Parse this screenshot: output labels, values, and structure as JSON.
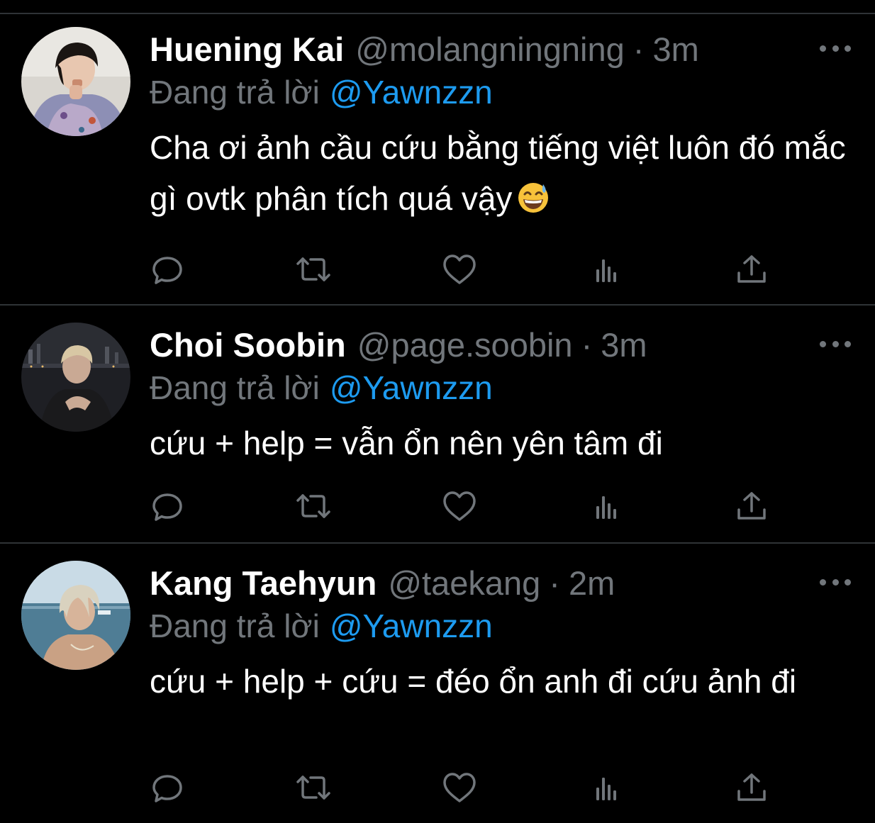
{
  "tweets": [
    {
      "name": "Huening Kai",
      "handle": "@molangningning",
      "separator": "·",
      "time": "3m",
      "reply_prefix": "Đang trả lời",
      "reply_to": "@Yawnzzn",
      "text": "Cha ơi ảnh cầu cứu bằng tiếng việt luôn đó mắc gì ovtk phân tích quá vậy",
      "emoji": "grinning-face-with-sweat"
    },
    {
      "name": "Choi Soobin",
      "handle": "@page.soobin",
      "separator": "·",
      "time": "3m",
      "reply_prefix": "Đang trả lời",
      "reply_to": "@Yawnzzn",
      "text": "cứu + help = vẫn ổn nên yên tâm đi"
    },
    {
      "name": "Kang Taehyun",
      "handle": "@taekang",
      "separator": "·",
      "time": "2m",
      "reply_prefix": "Đang trả lời",
      "reply_to": "@Yawnzzn",
      "text": "cứu + help + cứu = đéo ổn anh đi cứu ảnh đi"
    }
  ],
  "icons": [
    "reply-icon",
    "retweet-icon",
    "like-icon",
    "views-icon",
    "share-icon",
    "more-icon"
  ],
  "colors": {
    "background": "#000000",
    "name": "#ffffff",
    "secondary": "#71767b",
    "mention": "#1d9bf0",
    "divider": "#2f3336"
  }
}
